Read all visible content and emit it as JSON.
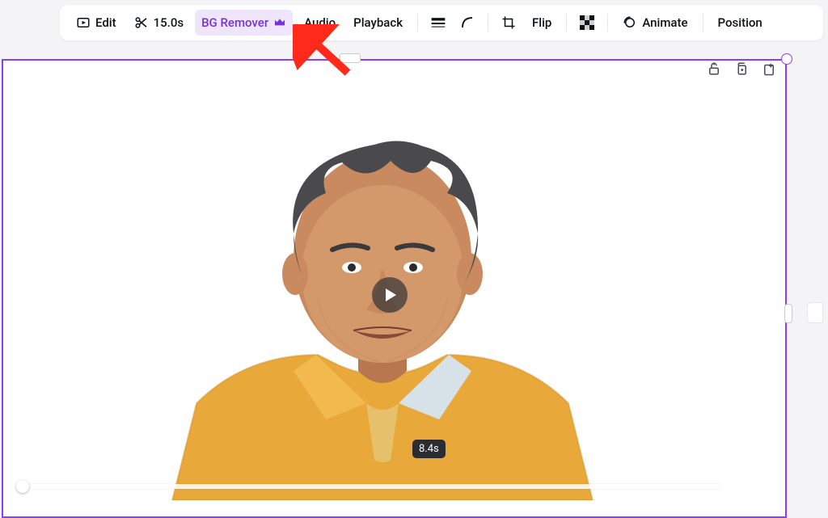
{
  "toolbar": {
    "edit": "Edit",
    "trim_duration": "15.0s",
    "bg_remover": "BG Remover",
    "audio": "Audio",
    "playback": "Playback",
    "flip": "Flip",
    "animate": "Animate",
    "position": "Position"
  },
  "video": {
    "current_time": "8.4s"
  },
  "colors": {
    "accent": "#8b3dff",
    "highlight_bg": "#efe6fd",
    "highlight_text": "#7731d8",
    "annotation_red": "#ff2a1a"
  },
  "icons": {
    "edit": "edit-box",
    "trim": "scissors",
    "premium": "crown",
    "weight": "line-weight",
    "corner": "corner-rounding",
    "crop": "crop",
    "transparency": "transparency-checker",
    "animate": "circle-swirl",
    "lock": "lock",
    "duplicate": "duplicate",
    "export": "export-page",
    "play": "play"
  }
}
